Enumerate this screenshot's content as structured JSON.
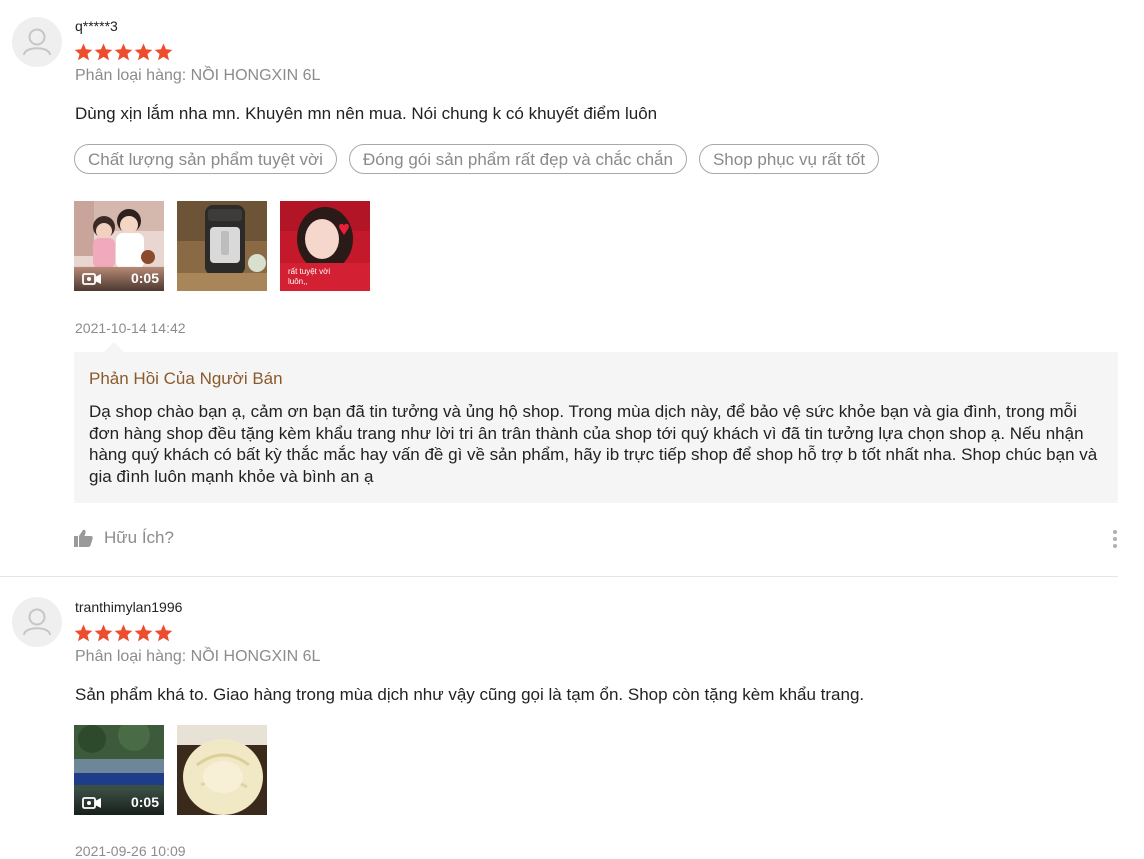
{
  "colors": {
    "star": "#ee4d2d",
    "reply_title": "#8b5a2b",
    "muted_text": "#8c8c8c",
    "reply_bg": "#f5f5f5"
  },
  "reviews": [
    {
      "author": "q*****3",
      "rating": 5,
      "variation": "Phân loại hàng: NỒI HONGXIN 6L",
      "content": "Dùng xịn lắm nha mn. Khuyên mn nên mua. Nói chung k có khuyết điểm luôn",
      "tags": [
        "Chất lượng sản phẩm tuyệt vời",
        "Đóng gói sản phẩm rất đẹp và chắc chắn",
        "Shop phục vụ rất tốt"
      ],
      "media": [
        {
          "type": "video",
          "duration": "0:05",
          "icon": "video-camera-icon"
        },
        {
          "type": "image"
        },
        {
          "type": "image",
          "caption": "rất tuyệt vời luôn,,"
        }
      ],
      "time": "2021-10-14 14:42",
      "seller_reply": {
        "title": "Phản Hồi Của Người Bán",
        "text": "Dạ shop chào bạn ạ, cảm ơn bạn đã tin tưởng và ủng hộ shop. Trong mùa dịch này, để bảo vệ sức khỏe bạn và gia đình, trong mỗi đơn hàng shop đều tặng kèm khẩu trang như lời tri ân trân thành của shop tới quý khách vì đã tin tưởng lựa chọn shop ạ. Nếu nhận hàng quý khách có bất kỳ thắc mắc hay vấn đề gì về sản phẩm, hãy ib trực tiếp shop để shop hỗ trợ b tốt nhất nha. Shop chúc bạn và gia đình luôn mạnh khỏe và bình an ạ"
      },
      "helpful_label": "Hữu Ích?",
      "helpful_icon": "thumbs-up-icon",
      "more_icon": "more-vertical-icon"
    },
    {
      "author": "tranthimylan1996",
      "rating": 5,
      "variation": "Phân loại hàng: NỒI HONGXIN 6L",
      "content": "Sản phẩm khá to. Giao hàng trong mùa dịch như vậy cũng gọi là tạm ổn. Shop còn tặng kèm khẩu trang.",
      "media": [
        {
          "type": "video",
          "duration": "0:05",
          "icon": "video-camera-icon"
        },
        {
          "type": "image"
        }
      ],
      "time": "2021-09-26 10:09"
    }
  ]
}
